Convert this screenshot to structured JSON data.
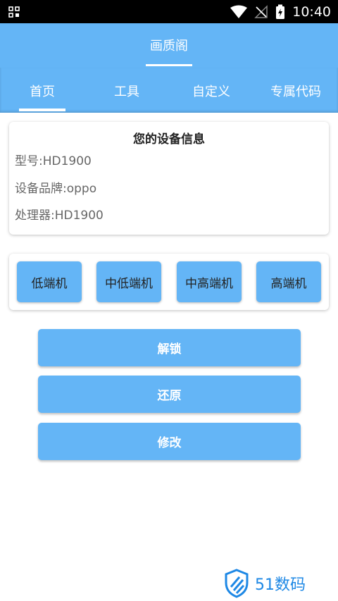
{
  "status_bar": {
    "time": "10:40",
    "icons": [
      "app-grid-icon",
      "wifi-icon",
      "no-signal-icon",
      "battery-charging-icon"
    ]
  },
  "toolbar": {
    "title": "画质阁"
  },
  "tabs": [
    {
      "label": "首页",
      "active": true
    },
    {
      "label": "工具",
      "active": false
    },
    {
      "label": "自定义",
      "active": false
    },
    {
      "label": "专属代码",
      "active": false
    }
  ],
  "device_info": {
    "title": "您的设备信息",
    "model": "型号:HD1900",
    "brand": "设备品牌:oppo",
    "processor": "处理器:HD1900"
  },
  "tiers": [
    "低端机",
    "中低端机",
    "中高端机",
    "高端机"
  ],
  "actions": {
    "unlock": "解锁",
    "restore": "还原",
    "modify": "修改"
  },
  "watermark": {
    "text": "51数码"
  },
  "colors": {
    "primary": "#64b5f6",
    "status_bar": "#000000",
    "watermark": "#1e88e5"
  }
}
